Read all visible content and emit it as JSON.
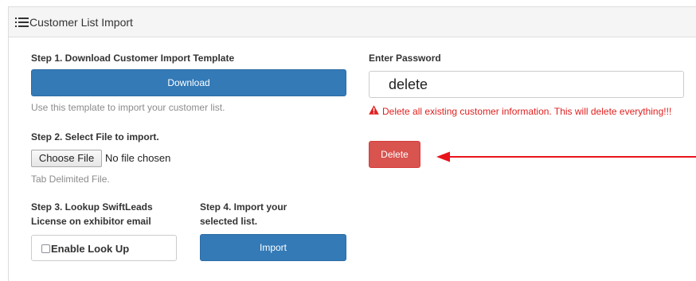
{
  "panel": {
    "title": "Customer List Import",
    "icon": "list-icon"
  },
  "step1": {
    "label": "Step 1. Download Customer Import Template",
    "button_label": "Download",
    "help": "Use this template to import your customer list."
  },
  "step2": {
    "label": "Step 2. Select File to import.",
    "choose_label": "Choose File",
    "file_status": "No file chosen",
    "help": "Tab Delimited File."
  },
  "step3": {
    "label_line1": "Step 3. Lookup SwiftLeads",
    "label_line2": "License on exhibitor email",
    "checkbox_label": "Enable Look Up",
    "checked": false
  },
  "step4": {
    "label_line1": "Step 4. Import your",
    "label_line2": "selected list.",
    "button_label": "Import"
  },
  "password": {
    "label": "Enter Password",
    "value": "delete"
  },
  "warning": {
    "icon": "warning-icon",
    "text": "Delete all existing customer information. This will delete everything!!!"
  },
  "delete_button": {
    "label": "Delete"
  },
  "colors": {
    "primary": "#337ab7",
    "danger": "#d9534f",
    "warning_text": "#e02020",
    "annotation_arrow": "#e8141c"
  }
}
